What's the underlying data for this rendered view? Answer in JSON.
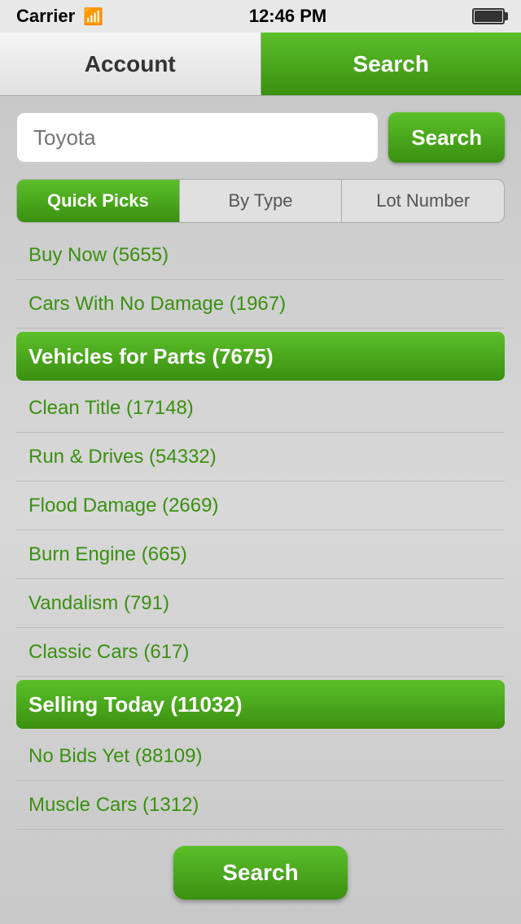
{
  "statusBar": {
    "carrier": "Carrier",
    "time": "12:46 PM"
  },
  "tabs": {
    "account": "Account",
    "search": "Search"
  },
  "searchBar": {
    "placeholder": "Toyota",
    "buttonLabel": "Search"
  },
  "filterTabs": [
    {
      "id": "quick-picks",
      "label": "Quick Picks",
      "active": true
    },
    {
      "id": "by-type",
      "label": "By Type",
      "active": false
    },
    {
      "id": "lot-number",
      "label": "Lot Number",
      "active": false
    }
  ],
  "listItems": [
    {
      "id": "buy-now",
      "label": "Buy Now (5655)",
      "highlighted": false
    },
    {
      "id": "no-damage",
      "label": "Cars With No Damage (1967)",
      "highlighted": false
    },
    {
      "id": "vehicles-parts",
      "label": "Vehicles for Parts (7675)",
      "highlighted": true
    },
    {
      "id": "clean-title",
      "label": "Clean Title (17148)",
      "highlighted": false
    },
    {
      "id": "run-drives",
      "label": "Run & Drives (54332)",
      "highlighted": false
    },
    {
      "id": "flood-damage",
      "label": "Flood Damage (2669)",
      "highlighted": false
    },
    {
      "id": "burn-engine",
      "label": "Burn Engine (665)",
      "highlighted": false
    },
    {
      "id": "vandalism",
      "label": "Vandalism (791)",
      "highlighted": false
    },
    {
      "id": "classic-cars",
      "label": "Classic Cars (617)",
      "highlighted": false
    },
    {
      "id": "selling-today",
      "label": "Selling Today (11032)",
      "highlighted": true
    },
    {
      "id": "no-bids",
      "label": "No Bids Yet (88109)",
      "highlighted": false
    },
    {
      "id": "muscle-cars",
      "label": "Muscle Cars (1312)",
      "highlighted": false
    }
  ],
  "bottomButton": {
    "label": "Search"
  }
}
